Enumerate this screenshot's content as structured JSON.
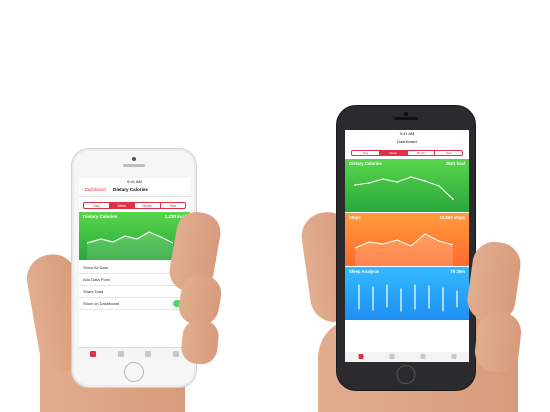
{
  "small_phone": {
    "time": "9:41 AM",
    "back_label": "Dashboard",
    "title": "Dietary Calories",
    "segments": [
      "Day",
      "Week",
      "Month",
      "Year"
    ],
    "active_segment": "Week",
    "card": {
      "title": "Dietary Calories",
      "value": "1,230 kcal"
    },
    "actions": [
      "Show All Data",
      "Add Data Point",
      "Share Data",
      "Show on Dashboard"
    ],
    "show_on_dashboard_enabled": true,
    "tabs": [
      "dashboard-icon",
      "health-data-icon",
      "sources-icon",
      "medical-id-icon"
    ]
  },
  "big_phone": {
    "time": "9:41 AM",
    "title": "Dashboard",
    "segments": [
      "Day",
      "Week",
      "Month",
      "Year"
    ],
    "active_segment": "Week",
    "cards": [
      {
        "title": "Dietary Calories",
        "value": "2621 kcal",
        "color": "#4ccd45"
      },
      {
        "title": "Steps",
        "value": "12,860 steps",
        "color": "#ff8734"
      },
      {
        "title": "Sleep Analysis",
        "value": "7h 29m",
        "color": "#28a8f8"
      }
    ],
    "tabs": [
      "dashboard-icon",
      "health-data-icon",
      "sources-icon",
      "medical-id-icon"
    ]
  },
  "colors": {
    "accent": "#e0304a",
    "calories_green": "#4ccd45",
    "steps_orange": "#ff8734",
    "sleep_blue": "#28a8f8",
    "toggle_on": "#4cd964"
  }
}
